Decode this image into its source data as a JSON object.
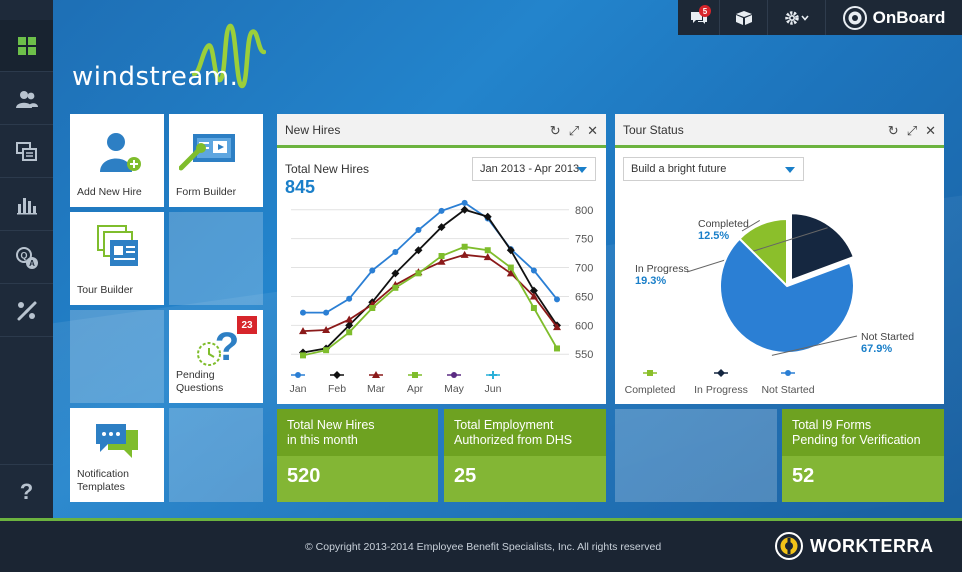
{
  "brand": {
    "logo_text": "windstream.",
    "app_name": "OnBoard",
    "footer_brand": "WORKTERRA"
  },
  "topbar": {
    "chat_badge": "5"
  },
  "sidebar": {
    "items": [
      {
        "icon": "dashboard-icon"
      },
      {
        "icon": "users-icon"
      },
      {
        "icon": "screens-icon"
      },
      {
        "icon": "bar-chart-icon"
      },
      {
        "icon": "search-person-icon"
      },
      {
        "icon": "tools-icon"
      }
    ],
    "help": "?"
  },
  "tiles": {
    "add_new_hire": "Add New Hire",
    "form_builder": "Form Builder",
    "tour_builder": "Tour Builder",
    "pending_questions": "Pending Questions",
    "pending_badge": "23",
    "notification_templates": "Notification Templates"
  },
  "new_hires": {
    "title": "New Hires",
    "total_label": "Total New Hires",
    "total_value": "845",
    "range": "Jan 2013 - Apr 2013"
  },
  "tour_status": {
    "title": "Tour Status",
    "select": "Build a bright future"
  },
  "stats": {
    "month": {
      "label_1": "Total New Hires",
      "label_2": "in this month",
      "value": "520"
    },
    "dhs": {
      "label_1": "Total Employment",
      "label_2": "Authorized from DHS",
      "value": "25"
    },
    "i9": {
      "label_1": "Total I9 Forms",
      "label_2": "Pending for Verification",
      "value": "52"
    }
  },
  "footer": {
    "copyright": "© Copyright 2013-2014 Employee Benefit Specialists, Inc. All rights reserved"
  },
  "chart_data": [
    {
      "type": "line",
      "categories": [
        "Jan",
        "Feb",
        "Mar",
        "Apr",
        "May",
        "Jun"
      ],
      "ylim": [
        540,
        810
      ],
      "yticks": [
        550,
        600,
        650,
        700,
        750,
        800
      ],
      "x_points": 12,
      "series": [
        {
          "color": "#2b7fd4",
          "marker": "circle",
          "values": [
            622,
            622,
            646,
            695,
            727,
            765,
            798,
            812,
            785,
            732,
            695,
            645
          ]
        },
        {
          "color": "#111111",
          "marker": "diamond",
          "values": [
            553,
            560,
            600,
            640,
            690,
            730,
            770,
            800,
            788,
            730,
            660,
            600
          ]
        },
        {
          "color": "#8b1a1a",
          "marker": "triangle",
          "values": [
            590,
            592,
            610,
            636,
            670,
            692,
            710,
            722,
            718,
            690,
            650,
            597
          ]
        },
        {
          "color": "#7fbd2c",
          "marker": "square",
          "values": [
            548,
            557,
            588,
            630,
            665,
            690,
            720,
            736,
            730,
            700,
            630,
            560
          ]
        }
      ],
      "legend_markers": [
        "circle",
        "diamond",
        "triangle",
        "square",
        "circle",
        "cross"
      ],
      "legend_colors": [
        "#2b7fd4",
        "#111111",
        "#8b1a1a",
        "#7fbd2c",
        "#5a2a82",
        "#2bb0d8"
      ]
    },
    {
      "type": "pie",
      "slices": [
        {
          "name": "Completed",
          "value": 12.5,
          "label": "12.5%",
          "color": "#8bbf2b"
        },
        {
          "name": "In Progress",
          "value": 19.3,
          "label": "19.3%",
          "color": "#152740"
        },
        {
          "name": "Not Started",
          "value": 67.9,
          "label": "67.9%",
          "color": "#2b7fd4"
        }
      ],
      "legend": [
        "Completed",
        "In Progress",
        "Not Started"
      ]
    }
  ],
  "colors": {
    "accent_green": "#6cb33f",
    "stat_green": "#83b635",
    "blue": "#1a7fc9",
    "badge_red": "#d7252b"
  }
}
